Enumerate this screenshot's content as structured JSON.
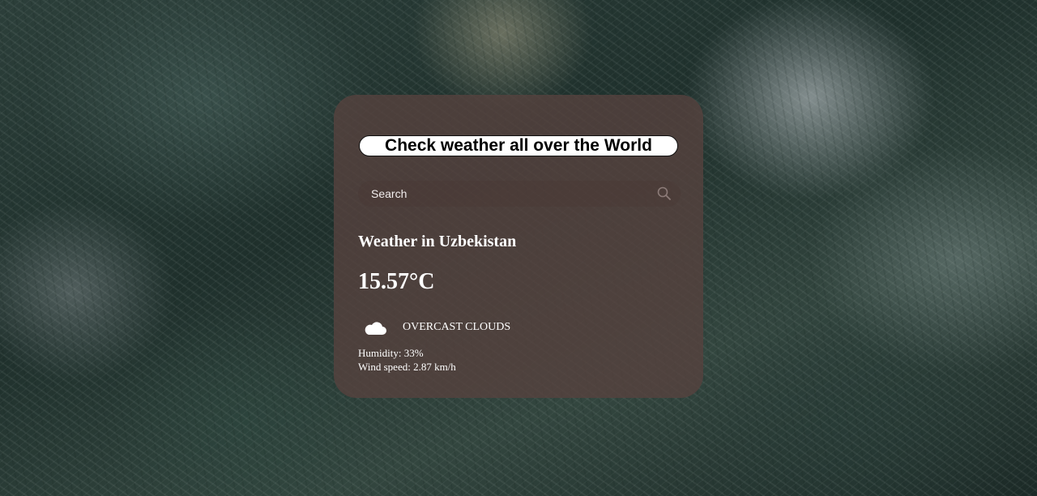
{
  "app": {
    "title": "Check weather all over the World"
  },
  "search": {
    "placeholder": "Search",
    "value": "",
    "button_icon": "search-icon"
  },
  "weather": {
    "heading": "Weather in Uzbekistan",
    "temperature": "15.57°C",
    "condition_icon": "cloud-icon",
    "description": "OVERCAST CLOUDS",
    "humidity": "Humidity: 33%",
    "wind_speed": "Wind speed: 2.87 km/h"
  },
  "colors": {
    "card_background": "#56423e",
    "text": "#ffffff",
    "title_pill_background": "#ffffff",
    "title_pill_text": "#000000"
  }
}
